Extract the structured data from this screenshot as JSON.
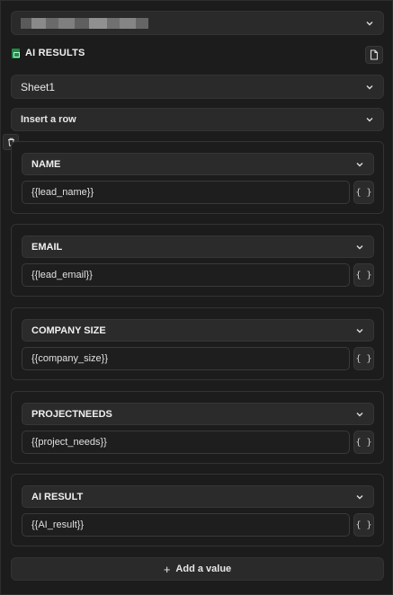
{
  "account": {
    "label_hidden": true
  },
  "section": {
    "title": "AI RESULTS",
    "icon": "google-sheets-icon"
  },
  "sheet_select": {
    "value": "Sheet1"
  },
  "action_select": {
    "value": "Insert a row"
  },
  "fields": [
    {
      "name": "NAME",
      "value": "{{lead_name}}"
    },
    {
      "name": "EMAIL",
      "value": "{{lead_email}}"
    },
    {
      "name": "COMPANY SIZE",
      "value": "{{company_size}}"
    },
    {
      "name": "PROJECTNEEDS",
      "value": "{{project_needs}}"
    },
    {
      "name": "AI RESULT",
      "value": "{{AI_result}}"
    }
  ],
  "variable_button_label": "{ }",
  "add_value": {
    "icon": "+",
    "label": "Add a value"
  },
  "colors": {
    "panel": "#1c1c1c",
    "field": "#2b2b2b",
    "sheets_green": "#1f8a4c"
  }
}
